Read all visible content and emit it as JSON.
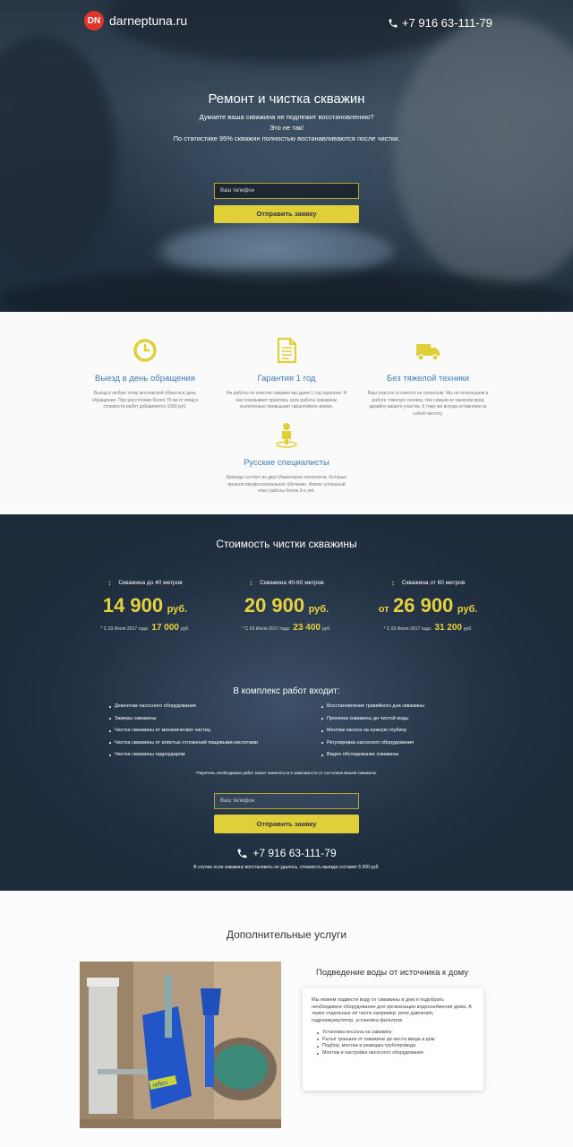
{
  "header": {
    "logo_mark": "DN",
    "logo_text": "darneptuna.ru",
    "phone": "+7 916 63-111-79"
  },
  "hero": {
    "title": "Ремонт и чистка скважин",
    "sub_lines": [
      "Думаете ваша скважина не подлежит восстановлению?",
      "Это не так!",
      "По статистике 95% скважин полностью востанавливаются после чистки."
    ],
    "phone_placeholder": "Ваш телефон",
    "submit_label": "Отправить заявку"
  },
  "features": [
    {
      "icon": "clock-icon",
      "title": "Выезд в день обращения",
      "text": "Выезд в любую точку московской области в день обращения. При расстоянии более 70 км от мкад к стоимости работ добавляется 1000 руб."
    },
    {
      "icon": "document-icon",
      "title": "Гарантия 1 год",
      "text": "На работы по очистке скважин мы даем 1 год гарантии. И как показывает практика, срок работы скважины значительно превышает гарантийное время."
    },
    {
      "icon": "truck-icon",
      "title": "Без тяжелой техники",
      "text": "Ваш участок останется не тронутым. Мы не используем в работе тяжелую технику, тем самым не наносим вред дизайну вашего участка. К тому же всегда оставляем за собой чистоту."
    },
    {
      "icon": "person-pin-icon",
      "title": "Русские специалисты",
      "text": "Бригада состоит из двух Инженеров-технологов. Которые прошли профессиональное обучение. Имеют успешный опыт работы более 3-х лет."
    }
  ],
  "prices": {
    "title": "Стоимость чистки скважины",
    "columns": [
      {
        "label": "Скважина до 40 метров",
        "prefix": "",
        "price": "14 900",
        "unit": "руб.",
        "old_prefix": "* С 03 Июля 2017 года:",
        "old_price": "17 000",
        "old_unit": "руб."
      },
      {
        "label": "Скважина 40-60 метров",
        "prefix": "",
        "price": "20 900",
        "unit": "руб.",
        "old_prefix": "* С 03 Июля 2017 года:",
        "old_price": "23 400",
        "old_unit": "руб."
      },
      {
        "label": "Скважина от 60 метров",
        "prefix": "от",
        "price": "26 900",
        "unit": "руб.",
        "old_prefix": "* С 03 Июля 2017 года:",
        "old_price": "31 200",
        "old_unit": "руб."
      }
    ],
    "included_title": "В комплекс работ входит:",
    "left_list": [
      "Демонтаж насосного оборудования",
      "Замеры скважины",
      "Чистка скважины от механических частиц",
      "Чистка скважины от илистых отложений пищевыми кислотами",
      "Чистка скважины гидроударом"
    ],
    "right_list": [
      "Восстановление гравийного дна скважины",
      "Прокачка скважины до чистой воды",
      "Монтаж насоса на нужную глубину",
      "Регулировка насосного оборудования",
      "Видео обследование скважины"
    ],
    "note": "*Перечень необходимых работ может изменяться в зависимости от состояния Вашей скважины.",
    "phone_placeholder": "Ваш телефон",
    "submit_label": "Отправить заявку",
    "phone": "+7 916 63-111-79",
    "footer_note": "В случае если скважину восстановить не удалось, стоимость выезда составит 5 000 руб."
  },
  "extra": {
    "title": "Дополнительные услуги",
    "service_title": "Подведение воды от источника к дому",
    "service_text": "Мы можем подвести воду от скважины в дом и подобрать необходимое оборудование для организации водоснабжения дома. А также отдельные её части например: реле давления, гидроаккумулятор, установка фильтров",
    "service_items": [
      "Установка кессона на скважину",
      "Рытьё траншеи от скважины до места ввода в дом",
      "Подбор, монтаж и разводка трубопровода",
      "Монтаж и настройка насосного оборудования"
    ],
    "photo_label": "reflex"
  },
  "colors": {
    "accent_yellow": "#e1cf3a",
    "link_blue": "#3d7bb8",
    "dark_blue": "#233244",
    "logo_red": "#e0352b"
  }
}
